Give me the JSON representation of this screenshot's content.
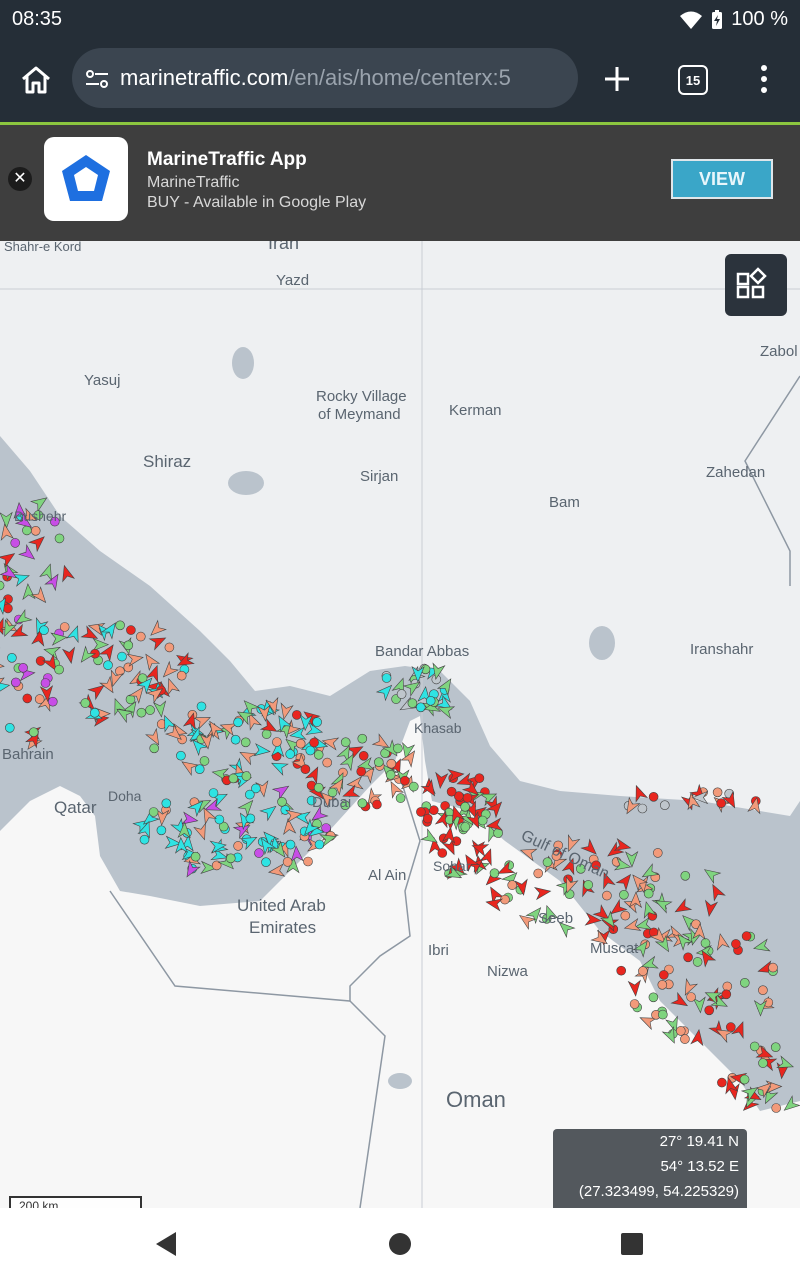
{
  "status_bar": {
    "time": "08:35",
    "battery": "100 %"
  },
  "browser": {
    "url_domain": "marinetraffic.com",
    "url_path": "/en/ais/home/centerx:5",
    "tab_count": "15"
  },
  "app_banner": {
    "app_name": "MarineTraffic App",
    "publisher": "MarineTraffic",
    "offer": "BUY - Available in Google Play",
    "view_label": "VIEW"
  },
  "map": {
    "labels": {
      "shahre_kord": "Shahr-e Kord",
      "iran": "Iran",
      "yazd": "Yazd",
      "zabol": "Zabol",
      "yasuj": "Yasuj",
      "rocky_village": "Rocky Village",
      "of_meymand": "of Meymand",
      "kerman": "Kerman",
      "shiraz": "Shiraz",
      "sirjan": "Sirjan",
      "zahedan": "Zahedan",
      "bushehr": "Bushehr",
      "bam": "Bam",
      "iranshahr": "Iranshahr",
      "bandar_abbas": "Bandar Abbas",
      "bahrain": "Bahrain",
      "qatar": "Qatar",
      "doha": "Doha",
      "dubai": "Dubai",
      "al_ain": "Al Ain",
      "uae_line1": "United Arab",
      "uae_line2": "Emirates",
      "seeb": "Seeb",
      "muscat": "Muscat",
      "ibri": "Ibri",
      "nizwa": "Nizwa",
      "oman": "Oman",
      "gulf_oman": "Gulf of Oman",
      "sohar": "Sohar",
      "khasab": "Khasab"
    },
    "coordinates": {
      "lat": "27° 19.41 N",
      "lon": "54° 13.52 E",
      "decimal": "(27.323499, 54.225329)"
    },
    "scale": "200 km"
  },
  "colors": {
    "cargo": "#7fd47f",
    "tanker": "#e8261f",
    "passenger": "#2fe3e3",
    "fishing": "#f29a7a",
    "pleasure": "#c74ee6",
    "tug": "#4a6de0",
    "other": "#bfc6cc"
  }
}
